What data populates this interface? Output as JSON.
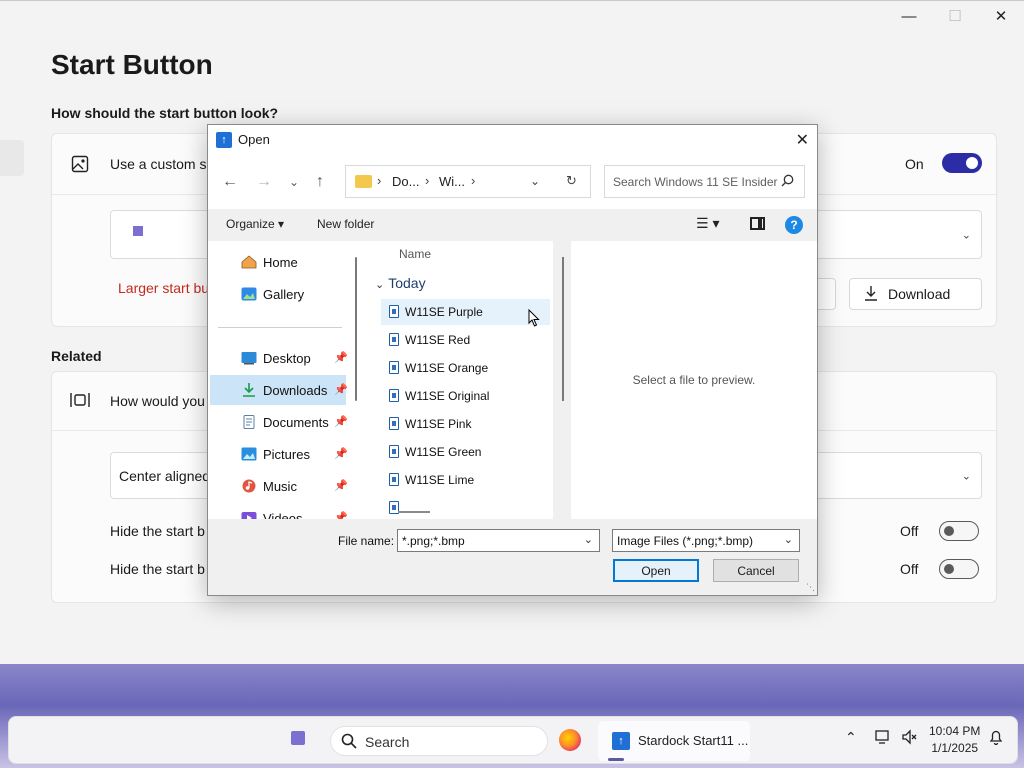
{
  "settings": {
    "page_title": "Start Button",
    "question": "How should the start button look?",
    "custom_row_label": "Use a custom s",
    "custom_state": "On",
    "warning_text": "Larger start bu",
    "download_label": "Download",
    "related_heading": "Related",
    "related_row_label": "How would you",
    "alignment_value": "Center aligned",
    "hide_row1_label": "Hide the start b",
    "hide_row1_state": "Off",
    "hide_row2_label": "Hide the start b",
    "hide_row2_state": "Off",
    "window_controls": [
      "minimize-icon",
      "maximize-icon",
      "close-icon"
    ]
  },
  "dialog": {
    "title": "Open",
    "breadcrumb": [
      "Do...",
      "Wi..."
    ],
    "search_placeholder": "Search Windows 11 SE Insider",
    "organize_label": "Organize",
    "new_folder_label": "New folder",
    "nav": {
      "top": [
        {
          "label": "Home",
          "icon": "home-icon"
        },
        {
          "label": "Gallery",
          "icon": "gallery-icon"
        }
      ],
      "pinned": [
        {
          "label": "Desktop",
          "icon": "desktop-icon",
          "selected": false
        },
        {
          "label": "Downloads",
          "icon": "download-icon",
          "selected": true
        },
        {
          "label": "Documents",
          "icon": "documents-icon",
          "selected": false
        },
        {
          "label": "Pictures",
          "icon": "pictures-icon",
          "selected": false
        },
        {
          "label": "Music",
          "icon": "music-icon",
          "selected": false
        },
        {
          "label": "Videos",
          "icon": "videos-icon",
          "selected": false
        }
      ]
    },
    "column_name": "Name",
    "group_today": "Today",
    "files": [
      "W11SE Purple",
      "W11SE Red",
      "W11SE Orange",
      "W11SE Original",
      "W11SE Pink",
      "W11SE Green",
      "W11SE Lime"
    ],
    "preview_message": "Select a file to preview.",
    "file_name_label": "File name:",
    "file_name_value": "*.png;*.bmp",
    "file_type_value": "Image Files (*.png;*.bmp)",
    "open_label": "Open",
    "cancel_label": "Cancel"
  },
  "taskbar": {
    "search_label": "Search",
    "app_label": "Stardock Start11 ...",
    "time": "10:04 PM",
    "date": "1/1/2025"
  },
  "colors": {
    "accent": "#2c2ca6",
    "warning": "#c42b1c",
    "selection": "#cce4f7",
    "dialog_default_border": "#0078d4"
  }
}
